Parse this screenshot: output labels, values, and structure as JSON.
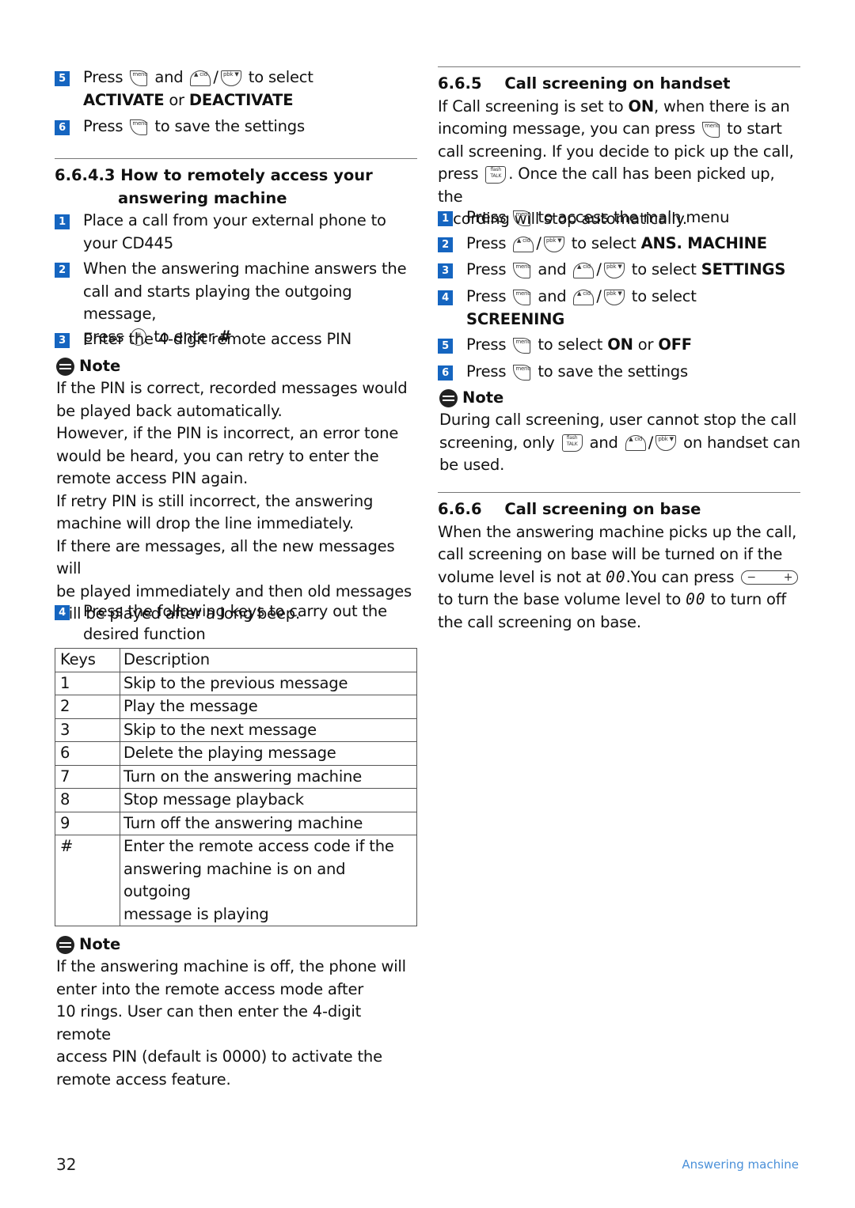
{
  "page": {
    "number": "32",
    "section_footer": "Answering machine",
    "accent_color": "#1565c0"
  },
  "left": {
    "top_steps": [
      {
        "num": "5",
        "pre": "Press",
        "mid": "and",
        "post": "to select",
        "bold1": "ACTIVATE",
        "or": "or",
        "bold2": "DEACTIVATE"
      },
      {
        "num": "6",
        "pre": "Press",
        "post": "to save the settings"
      }
    ],
    "section": {
      "number": "6.6.4.3",
      "title_line1": "How to remotely access your",
      "title_line2": "answering machine"
    },
    "steps": [
      {
        "num": "1",
        "line1": "Place a call from your external phone to",
        "line2": "your CD445"
      },
      {
        "num": "2",
        "line1": "When the answering machine answers the",
        "line2": "call and starts playing the outgoing message,",
        "pre3": "press",
        "post3": "to enter",
        "bold3": "#"
      },
      {
        "num": "3",
        "line1": "Enter the 4-digit remote access PIN"
      }
    ],
    "note1": {
      "title": "Note",
      "lines": [
        "If the PIN is correct, recorded messages would",
        "be played back automatically.",
        "However, if the PIN is incorrect, an error tone",
        "would be heard, you can retry to enter the",
        "remote access PIN again.",
        "If retry PIN is still incorrect, the answering",
        "machine will drop the line immediately.",
        "If there are messages, all the new messages will",
        "be played immediately and then old messages",
        "will be played after a long beep."
      ]
    },
    "step4": {
      "num": "4",
      "line1": "Press the following keys to carry out the",
      "line2": "desired function"
    },
    "table": {
      "headers": [
        "Keys",
        "Description"
      ],
      "rows": [
        {
          "key": "1",
          "desc": "Skip to the previous message"
        },
        {
          "key": "2",
          "desc": "Play the message"
        },
        {
          "key": "3",
          "desc": "Skip to the next message"
        },
        {
          "key": "6",
          "desc": "Delete the playing message"
        },
        {
          "key": "7",
          "desc": "Turn on the answering machine"
        },
        {
          "key": "8",
          "desc": "Stop message playback"
        },
        {
          "key": "9",
          "desc": "Turn off the answering machine"
        },
        {
          "key": "#",
          "desc1": "Enter the remote access code if the",
          "desc2": "answering machine is on and outgoing",
          "desc3": "message is playing"
        }
      ]
    },
    "note2": {
      "title": "Note",
      "lines": [
        "If the answering machine is off, the phone will",
        "enter into the remote access mode after",
        "10 rings. User can then enter the 4-digit remote",
        "access PIN (default is 0000) to activate the",
        "remote access feature."
      ]
    }
  },
  "right": {
    "section1": {
      "number": "6.6.5",
      "title": "Call screening on handset",
      "p1a": "If Call screening is set to",
      "p1b": "ON",
      "p1c": ", when there is an",
      "p2a": "incoming message, you can press",
      "p2b": "to start",
      "p3": "call screening. If you decide to pick up the call,",
      "p4a": "press",
      "p4b": ". Once the call has been picked up, the",
      "p5": "recording will stop automatically."
    },
    "steps": [
      {
        "num": "1",
        "pre": "Press",
        "post": "to access the main menu"
      },
      {
        "num": "2",
        "pre": "Press",
        "post": "to select",
        "bold": "ANS. MACHINE"
      },
      {
        "num": "3",
        "pre": "Press",
        "mid": "and",
        "post": "to select",
        "bold": "SETTINGS"
      },
      {
        "num": "4",
        "pre": "Press",
        "mid": "and",
        "post": "to select",
        "bold": "SCREENING"
      },
      {
        "num": "5",
        "pre": "Press",
        "post": "to select",
        "bold1": "ON",
        "or": "or",
        "bold2": "OFF"
      },
      {
        "num": "6",
        "pre": "Press",
        "post": "to save the settings"
      }
    ],
    "note": {
      "title": "Note",
      "l1": "During call screening, user cannot stop the call",
      "l2a": "screening, only",
      "l2b": "and",
      "l2c": "on handset can",
      "l3": "be used."
    },
    "section2": {
      "number": "6.6.6",
      "title": "Call screening on base",
      "l1": "When the answering machine picks up the call,",
      "l2": "call screening on base will be turned on if the",
      "l3a": "volume level is not at",
      "l3b": "00",
      "l3c": ".You can press",
      "l4a": "to turn the base volume level to",
      "l4b": "00",
      "l4c": "to turn off",
      "l5": "the call screening on base."
    }
  },
  "keys": {
    "menu": "menu",
    "cid": "▲ cid",
    "pbk": "pbk ▼",
    "talk": "flash TALK",
    "hash": "#",
    "vol_minus": "−",
    "vol_plus": "+",
    "slash": "/"
  }
}
